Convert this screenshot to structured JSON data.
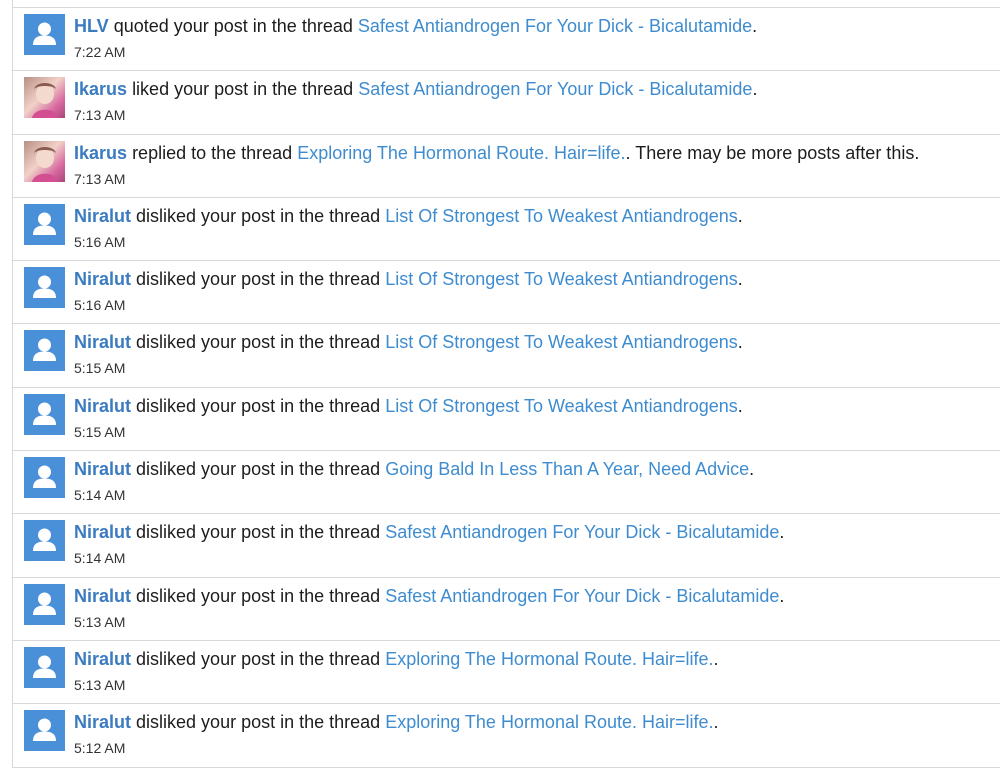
{
  "notifications": [
    {
      "user": "HLV",
      "action": "quoted your post in the thread",
      "thread": "Safest Antiandrogen For Your Dick - Bicalutamide",
      "suffix": ".",
      "time": "7:22 AM",
      "avatar": "default-user-icon"
    },
    {
      "user": "Ikarus",
      "action": "liked your post in the thread",
      "thread": "Safest Antiandrogen For Your Dick - Bicalutamide",
      "suffix": ".",
      "time": "7:13 AM",
      "avatar": "photo"
    },
    {
      "user": "Ikarus",
      "action": "replied to the thread",
      "thread": "Exploring The Hormonal Route. Hair=life.",
      "suffix": ". There may be more posts after this.",
      "time": "7:13 AM",
      "avatar": "photo"
    },
    {
      "user": "Niralut",
      "action": "disliked your post in the thread",
      "thread": "List Of Strongest To Weakest Antiandrogens",
      "suffix": ".",
      "time": "5:16 AM",
      "avatar": "default-user-icon"
    },
    {
      "user": "Niralut",
      "action": "disliked your post in the thread",
      "thread": "List Of Strongest To Weakest Antiandrogens",
      "suffix": ".",
      "time": "5:16 AM",
      "avatar": "default-user-icon"
    },
    {
      "user": "Niralut",
      "action": "disliked your post in the thread",
      "thread": "List Of Strongest To Weakest Antiandrogens",
      "suffix": ".",
      "time": "5:15 AM",
      "avatar": "default-user-icon"
    },
    {
      "user": "Niralut",
      "action": "disliked your post in the thread",
      "thread": "List Of Strongest To Weakest Antiandrogens",
      "suffix": ".",
      "time": "5:15 AM",
      "avatar": "default-user-icon"
    },
    {
      "user": "Niralut",
      "action": "disliked your post in the thread",
      "thread": "Going Bald In Less Than A Year, Need Advice",
      "suffix": ".",
      "time": "5:14 AM",
      "avatar": "default-user-icon"
    },
    {
      "user": "Niralut",
      "action": "disliked your post in the thread",
      "thread": "Safest Antiandrogen For Your Dick - Bicalutamide",
      "suffix": ".",
      "time": "5:14 AM",
      "avatar": "default-user-icon"
    },
    {
      "user": "Niralut",
      "action": "disliked your post in the thread",
      "thread": "Safest Antiandrogen For Your Dick - Bicalutamide",
      "suffix": ".",
      "time": "5:13 AM",
      "avatar": "default-user-icon"
    },
    {
      "user": "Niralut",
      "action": "disliked your post in the thread",
      "thread": "Exploring The Hormonal Route. Hair=life.",
      "suffix": ".",
      "time": "5:13 AM",
      "avatar": "default-user-icon"
    },
    {
      "user": "Niralut",
      "action": "disliked your post in the thread",
      "thread": "Exploring The Hormonal Route. Hair=life.",
      "suffix": ".",
      "time": "5:12 AM",
      "avatar": "default-user-icon"
    }
  ],
  "colors": {
    "username": "#3b7bc0",
    "thread_link": "#3e8ccf",
    "avatar_default": "#4a90d9",
    "divider": "#d8d8d8"
  }
}
